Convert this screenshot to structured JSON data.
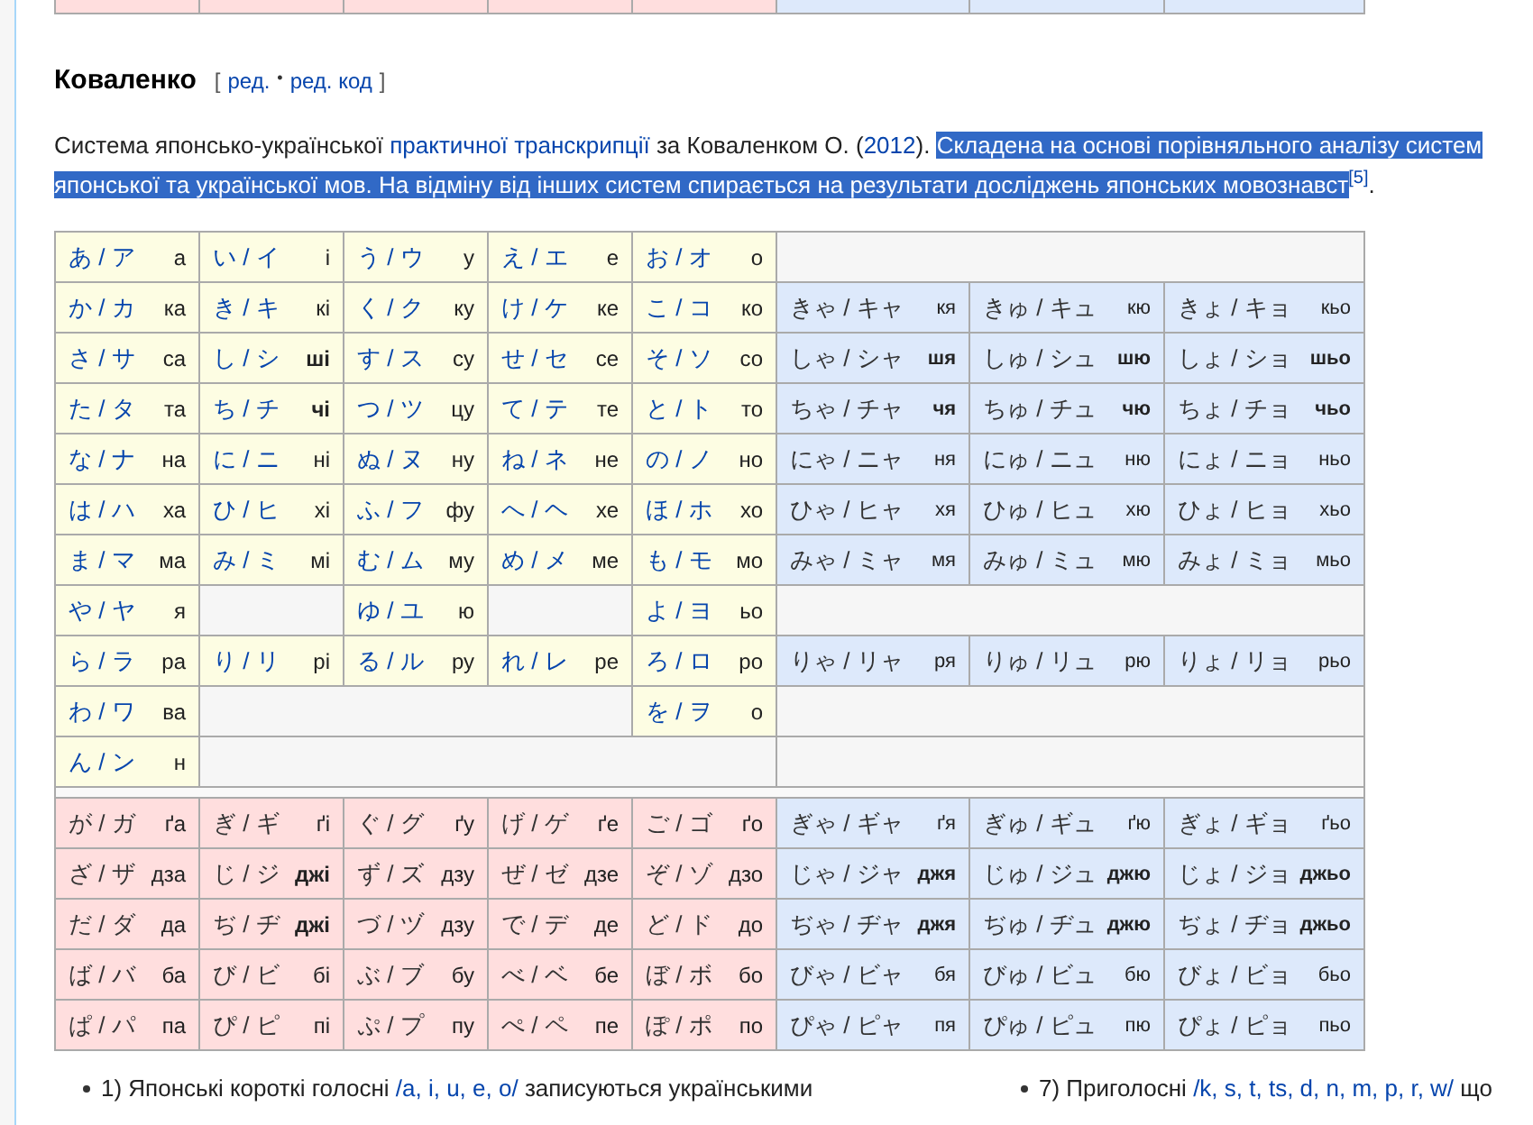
{
  "previous_table": {
    "cells": [
      {
        "kind": "voiced"
      },
      {
        "kind": "voiced"
      },
      {
        "kind": "voiced"
      },
      {
        "kind": "voiced"
      },
      {
        "kind": "voiced"
      },
      {
        "kind": "yoon"
      },
      {
        "kind": "yoon"
      },
      {
        "kind": "yoon"
      }
    ]
  },
  "section": {
    "heading": "Коваленко",
    "edit_links": {
      "open": "[",
      "items": [
        "ред.",
        "ред. код"
      ],
      "separator": "•",
      "close": "]"
    }
  },
  "paragraph": [
    {
      "text": "Система японсько-української ",
      "kind": "text",
      "selected": false
    },
    {
      "text": "практичної транскрипції",
      "kind": "link",
      "selected": false
    },
    {
      "text": " за Коваленком О. (",
      "kind": "text",
      "selected": false
    },
    {
      "text": "2012",
      "kind": "link",
      "selected": false
    },
    {
      "text": "). ",
      "kind": "text",
      "selected": false
    },
    {
      "text": "Складена на основі порівняльного аналізу систем японської та української мов. На відміну від інших систем спирається на результати досліджень японських мовознавст",
      "kind": "text",
      "selected": true
    },
    {
      "text": "[5]",
      "kind": "ref",
      "selected": false
    },
    {
      "text": ".",
      "kind": "text",
      "selected": false
    }
  ],
  "table": {
    "rows": [
      {
        "cells": [
          {
            "kana": "あ / ア",
            "translit": "а",
            "bold": false,
            "kind": "basic"
          },
          {
            "kana": "い / イ",
            "translit": "і",
            "bold": false,
            "kind": "basic"
          },
          {
            "kana": "う / ウ",
            "translit": "у",
            "bold": false,
            "kind": "basic"
          },
          {
            "kana": "え / エ",
            "translit": "е",
            "bold": false,
            "kind": "basic"
          },
          {
            "kana": "お / オ",
            "translit": "о",
            "bold": false,
            "kind": "basic"
          },
          {
            "kind": "blank-triple"
          }
        ]
      },
      {
        "cells": [
          {
            "kana": "か / カ",
            "translit": "ка",
            "bold": false,
            "kind": "basic"
          },
          {
            "kana": "き / キ",
            "translit": "кі",
            "bold": false,
            "kind": "basic"
          },
          {
            "kana": "く / ク",
            "translit": "ку",
            "bold": false,
            "kind": "basic"
          },
          {
            "kana": "け / ケ",
            "translit": "ке",
            "bold": false,
            "kind": "basic"
          },
          {
            "kana": "こ / コ",
            "translit": "ко",
            "bold": false,
            "kind": "basic"
          },
          {
            "kana": "きゃ / キャ",
            "translit": "кя",
            "bold": false,
            "kind": "yoon"
          },
          {
            "kana": "きゅ / キュ",
            "translit": "кю",
            "bold": false,
            "kind": "yoon"
          },
          {
            "kana": "きょ / キョ",
            "translit": "кьо",
            "bold": false,
            "kind": "yoon"
          }
        ]
      },
      {
        "cells": [
          {
            "kana": "さ / サ",
            "translit": "са",
            "bold": false,
            "kind": "basic"
          },
          {
            "kana": "し / シ",
            "translit": "ші",
            "bold": true,
            "kind": "basic"
          },
          {
            "kana": "す / ス",
            "translit": "су",
            "bold": false,
            "kind": "basic"
          },
          {
            "kana": "せ / セ",
            "translit": "се",
            "bold": false,
            "kind": "basic"
          },
          {
            "kana": "そ / ソ",
            "translit": "со",
            "bold": false,
            "kind": "basic"
          },
          {
            "kana": "しゃ / シャ",
            "translit": "шя",
            "bold": true,
            "kind": "yoon"
          },
          {
            "kana": "しゅ / シュ",
            "translit": "шю",
            "bold": true,
            "kind": "yoon"
          },
          {
            "kana": "しょ / ショ",
            "translit": "шьо",
            "bold": true,
            "kind": "yoon"
          }
        ]
      },
      {
        "cells": [
          {
            "kana": "た / タ",
            "translit": "та",
            "bold": false,
            "kind": "basic"
          },
          {
            "kana": "ち / チ",
            "translit": "чі",
            "bold": true,
            "kind": "basic"
          },
          {
            "kana": "つ / ツ",
            "translit": "цу",
            "bold": false,
            "kind": "basic"
          },
          {
            "kana": "て / テ",
            "translit": "те",
            "bold": false,
            "kind": "basic"
          },
          {
            "kana": "と / ト",
            "translit": "то",
            "bold": false,
            "kind": "basic"
          },
          {
            "kana": "ちゃ / チャ",
            "translit": "чя",
            "bold": true,
            "kind": "yoon"
          },
          {
            "kana": "ちゅ / チュ",
            "translit": "чю",
            "bold": true,
            "kind": "yoon"
          },
          {
            "kana": "ちょ / チョ",
            "translit": "чьо",
            "bold": true,
            "kind": "yoon"
          }
        ]
      },
      {
        "cells": [
          {
            "kana": "な / ナ",
            "translit": "на",
            "bold": false,
            "kind": "basic"
          },
          {
            "kana": "に / ニ",
            "translit": "ні",
            "bold": false,
            "kind": "basic"
          },
          {
            "kana": "ぬ / ヌ",
            "translit": "ну",
            "bold": false,
            "kind": "basic"
          },
          {
            "kana": "ね / ネ",
            "translit": "не",
            "bold": false,
            "kind": "basic"
          },
          {
            "kana": "の / ノ",
            "translit": "но",
            "bold": false,
            "kind": "basic"
          },
          {
            "kana": "にゃ / ニャ",
            "translit": "ня",
            "bold": false,
            "kind": "yoon"
          },
          {
            "kana": "にゅ / ニュ",
            "translit": "ню",
            "bold": false,
            "kind": "yoon"
          },
          {
            "kana": "にょ / ニョ",
            "translit": "ньо",
            "bold": false,
            "kind": "yoon"
          }
        ]
      },
      {
        "cells": [
          {
            "kana": "は / ハ",
            "translit": "ха",
            "bold": false,
            "kind": "basic"
          },
          {
            "kana": "ひ / ヒ",
            "translit": "хі",
            "bold": false,
            "kind": "basic"
          },
          {
            "kana": "ふ / フ",
            "translit": "фу",
            "bold": false,
            "kind": "basic"
          },
          {
            "kana": "へ / ヘ",
            "translit": "хе",
            "bold": false,
            "kind": "basic"
          },
          {
            "kana": "ほ / ホ",
            "translit": "хо",
            "bold": false,
            "kind": "basic"
          },
          {
            "kana": "ひゃ / ヒャ",
            "translit": "хя",
            "bold": false,
            "kind": "yoon"
          },
          {
            "kana": "ひゅ / ヒュ",
            "translit": "хю",
            "bold": false,
            "kind": "yoon"
          },
          {
            "kana": "ひょ / ヒョ",
            "translit": "хьо",
            "bold": false,
            "kind": "yoon"
          }
        ]
      },
      {
        "cells": [
          {
            "kana": "ま / マ",
            "translit": "ма",
            "bold": false,
            "kind": "basic"
          },
          {
            "kana": "み / ミ",
            "translit": "мі",
            "bold": false,
            "kind": "basic"
          },
          {
            "kana": "む / ム",
            "translit": "му",
            "bold": false,
            "kind": "basic"
          },
          {
            "kana": "め / メ",
            "translit": "ме",
            "bold": false,
            "kind": "basic"
          },
          {
            "kana": "も / モ",
            "translit": "мо",
            "bold": false,
            "kind": "basic"
          },
          {
            "kana": "みゃ / ミャ",
            "translit": "мя",
            "bold": false,
            "kind": "yoon"
          },
          {
            "kana": "みゅ / ミュ",
            "translit": "мю",
            "bold": false,
            "kind": "yoon"
          },
          {
            "kana": "みょ / ミョ",
            "translit": "мьо",
            "bold": false,
            "kind": "yoon"
          }
        ]
      },
      {
        "cells": [
          {
            "kana": "や / ヤ",
            "translit": "я",
            "bold": false,
            "kind": "basic"
          },
          {
            "kind": "blank"
          },
          {
            "kana": "ゆ / ユ",
            "translit": "ю",
            "bold": false,
            "kind": "basic"
          },
          {
            "kind": "blank"
          },
          {
            "kana": "よ / ヨ",
            "translit": "ьо",
            "bold": false,
            "kind": "basic"
          },
          {
            "kind": "blank-triple"
          }
        ]
      },
      {
        "cells": [
          {
            "kana": "ら / ラ",
            "translit": "ра",
            "bold": false,
            "kind": "basic"
          },
          {
            "kana": "り / リ",
            "translit": "рі",
            "bold": false,
            "kind": "basic"
          },
          {
            "kana": "る / ル",
            "translit": "ру",
            "bold": false,
            "kind": "basic"
          },
          {
            "kana": "れ / レ",
            "translit": "ре",
            "bold": false,
            "kind": "basic"
          },
          {
            "kana": "ろ / ロ",
            "translit": "ро",
            "bold": false,
            "kind": "basic"
          },
          {
            "kana": "りゃ / リャ",
            "translit": "ря",
            "bold": false,
            "kind": "yoon"
          },
          {
            "kana": "りゅ / リュ",
            "translit": "рю",
            "bold": false,
            "kind": "yoon"
          },
          {
            "kana": "りょ / リョ",
            "translit": "рьо",
            "bold": false,
            "kind": "yoon"
          }
        ]
      },
      {
        "cells": [
          {
            "kana": "わ / ワ",
            "translit": "ва",
            "bold": false,
            "kind": "basic"
          },
          {
            "kind": "blank-triple"
          },
          {
            "kana": "を / ヲ",
            "translit": "о",
            "bold": false,
            "kind": "basic"
          },
          {
            "kind": "blank-triple"
          }
        ]
      },
      {
        "cells": [
          {
            "kana": "ん / ン",
            "translit": "н",
            "bold": false,
            "kind": "basic"
          },
          {
            "kind": "blank-quad"
          },
          {
            "kind": "blank-triple"
          }
        ]
      },
      {
        "kind": "spacer"
      },
      {
        "cells": [
          {
            "kana": "が / ガ",
            "translit": "ґа",
            "bold": false,
            "kind": "voiced"
          },
          {
            "kana": "ぎ / ギ",
            "translit": "ґі",
            "bold": false,
            "kind": "voiced"
          },
          {
            "kana": "ぐ / グ",
            "translit": "ґу",
            "bold": false,
            "kind": "voiced"
          },
          {
            "kana": "げ / ゲ",
            "translit": "ґе",
            "bold": false,
            "kind": "voiced"
          },
          {
            "kana": "ご / ゴ",
            "translit": "ґо",
            "bold": false,
            "kind": "voiced"
          },
          {
            "kana": "ぎゃ / ギャ",
            "translit": "ґя",
            "bold": false,
            "kind": "yoon"
          },
          {
            "kana": "ぎゅ / ギュ",
            "translit": "ґю",
            "bold": false,
            "kind": "yoon"
          },
          {
            "kana": "ぎょ / ギョ",
            "translit": "ґьо",
            "bold": false,
            "kind": "yoon"
          }
        ]
      },
      {
        "cells": [
          {
            "kana": "ざ / ザ",
            "translit": "дза",
            "bold": false,
            "kind": "voiced"
          },
          {
            "kana": "じ / ジ",
            "translit": "джі",
            "bold": true,
            "kind": "voiced"
          },
          {
            "kana": "ず / ズ",
            "translit": "дзу",
            "bold": false,
            "kind": "voiced"
          },
          {
            "kana": "ぜ / ゼ",
            "translit": "дзе",
            "bold": false,
            "kind": "voiced"
          },
          {
            "kana": "ぞ / ゾ",
            "translit": "дзо",
            "bold": false,
            "kind": "voiced"
          },
          {
            "kana": "じゃ / ジャ",
            "translit": "джя",
            "bold": true,
            "kind": "yoon"
          },
          {
            "kana": "じゅ / ジュ",
            "translit": "джю",
            "bold": true,
            "kind": "yoon"
          },
          {
            "kana": "じょ / ジョ",
            "translit": "джьо",
            "bold": true,
            "kind": "yoon"
          }
        ]
      },
      {
        "cells": [
          {
            "kana": "だ / ダ",
            "translit": "да",
            "bold": false,
            "kind": "voiced"
          },
          {
            "kana": "ぢ / ヂ",
            "translit": "джі",
            "bold": true,
            "kind": "voiced"
          },
          {
            "kana": "づ / ヅ",
            "translit": "дзу",
            "bold": false,
            "kind": "voiced"
          },
          {
            "kana": "で / デ",
            "translit": "де",
            "bold": false,
            "kind": "voiced"
          },
          {
            "kana": "ど / ド",
            "translit": "до",
            "bold": false,
            "kind": "voiced"
          },
          {
            "kana": "ぢゃ / ヂャ",
            "translit": "джя",
            "bold": true,
            "kind": "yoon"
          },
          {
            "kana": "ぢゅ / ヂュ",
            "translit": "джю",
            "bold": true,
            "kind": "yoon"
          },
          {
            "kana": "ぢょ / ヂョ",
            "translit": "джьо",
            "bold": true,
            "kind": "yoon"
          }
        ]
      },
      {
        "cells": [
          {
            "kana": "ば / バ",
            "translit": "ба",
            "bold": false,
            "kind": "voiced"
          },
          {
            "kana": "び / ビ",
            "translit": "бі",
            "bold": false,
            "kind": "voiced"
          },
          {
            "kana": "ぶ / ブ",
            "translit": "бу",
            "bold": false,
            "kind": "voiced"
          },
          {
            "kana": "べ / ベ",
            "translit": "бе",
            "bold": false,
            "kind": "voiced"
          },
          {
            "kana": "ぼ / ボ",
            "translit": "бо",
            "bold": false,
            "kind": "voiced"
          },
          {
            "kana": "びゃ / ビャ",
            "translit": "бя",
            "bold": false,
            "kind": "yoon"
          },
          {
            "kana": "びゅ / ビュ",
            "translit": "бю",
            "bold": false,
            "kind": "yoon"
          },
          {
            "kana": "びょ / ビョ",
            "translit": "бьо",
            "bold": false,
            "kind": "yoon"
          }
        ]
      },
      {
        "cells": [
          {
            "kana": "ぱ / パ",
            "translit": "па",
            "bold": false,
            "kind": "voiced"
          },
          {
            "kana": "ぴ / ピ",
            "translit": "пі",
            "bold": false,
            "kind": "voiced"
          },
          {
            "kana": "ぷ / プ",
            "translit": "пу",
            "bold": false,
            "kind": "voiced"
          },
          {
            "kana": "ぺ / ペ",
            "translit": "пе",
            "bold": false,
            "kind": "voiced"
          },
          {
            "kana": "ぽ / ポ",
            "translit": "по",
            "bold": false,
            "kind": "voiced"
          },
          {
            "kana": "ぴゃ / ピャ",
            "translit": "пя",
            "bold": false,
            "kind": "yoon"
          },
          {
            "kana": "ぴゅ / ピュ",
            "translit": "пю",
            "bold": false,
            "kind": "yoon"
          },
          {
            "kana": "ぴょ / ピョ",
            "translit": "пьо",
            "bold": false,
            "kind": "yoon"
          }
        ]
      }
    ]
  },
  "notes": [
    {
      "before": "1) Японські короткі голосні ",
      "link": "/a, i, u, e, o/",
      "after": " записуються українськими"
    },
    {
      "before": "7) Приголосні ",
      "link": "/k, s, t, ts, d, n, m, p, r, w/",
      "after": " що"
    }
  ]
}
